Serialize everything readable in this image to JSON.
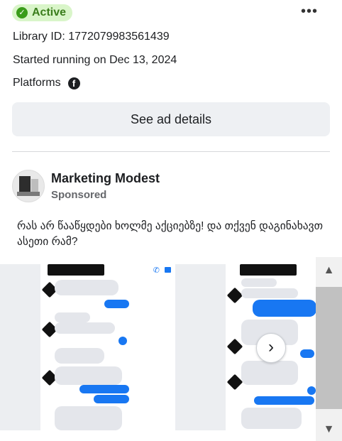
{
  "status": {
    "label": "Active",
    "icon": "check-circle-icon",
    "color": "#3a9c1a"
  },
  "menu": {
    "more_icon": "ellipsis-icon",
    "glyph": "•••"
  },
  "meta": {
    "library_id": "Library ID: 1772079983561439",
    "started": "Started running on Dec 13, 2024",
    "platforms_label": "Platforms",
    "platform_icon": "facebook-icon"
  },
  "details_button": {
    "label": "See ad details"
  },
  "advertiser": {
    "name": "Marketing Modest",
    "sponsored": "Sponsored"
  },
  "caption": "რას არ წააწყდები ხოლმე აქციებზე! და თქვენ დაგინახავთ ასეთი რამ?",
  "carousel": {
    "next_icon": "chevron-right-icon",
    "next_glyph": "›"
  },
  "scrollbar": {
    "up_glyph": "▲",
    "down_glyph": "▼"
  }
}
